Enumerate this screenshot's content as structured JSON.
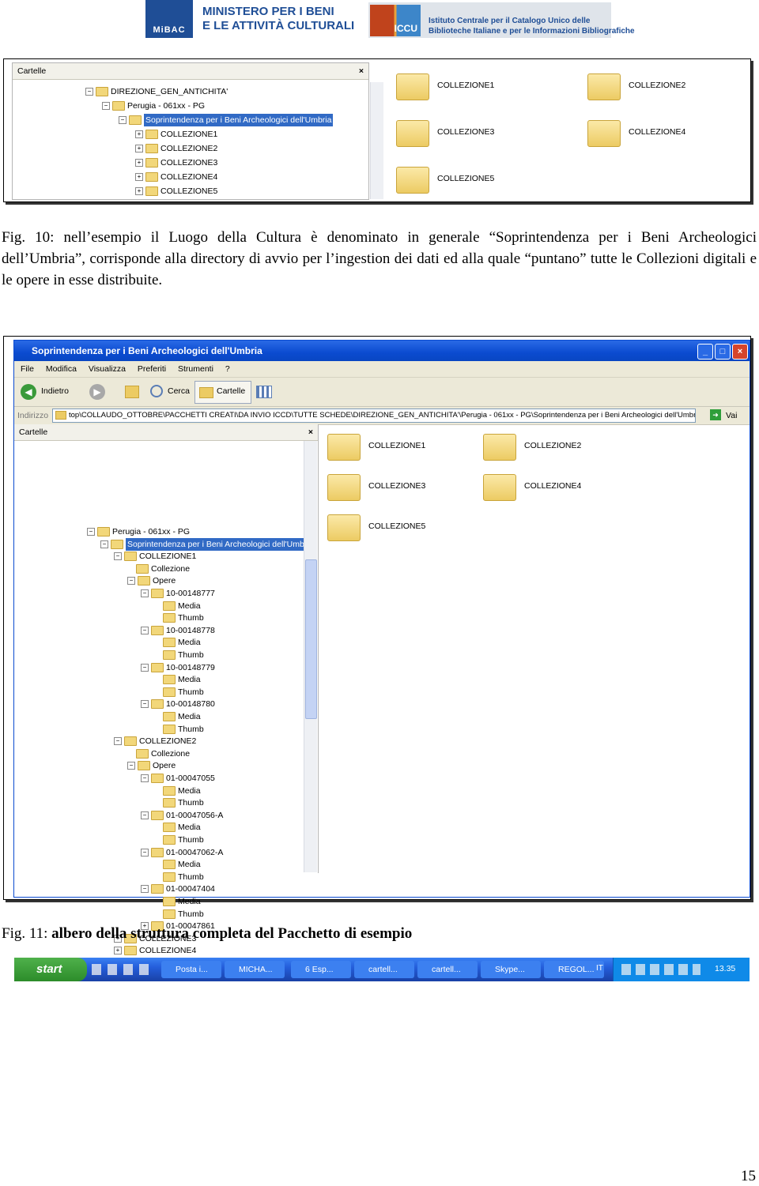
{
  "header": {
    "mibac_logo_text": "MiBAC",
    "ministry_line1": "MINISTERO PER I BENI",
    "ministry_line2": "E LE ATTIVITÀ CULTURALI",
    "iccu_logo_text": "ICCU",
    "iccu_line1": "Istituto Centrale per il Catalogo Unico delle",
    "iccu_line2": "Biblioteche Italiane e per le Informazioni Bibliografiche"
  },
  "fig10": {
    "panel_title": "Cartelle",
    "close": "×",
    "tree": [
      {
        "sign": "−",
        "label": "DIREZIONE_GEN_ANTICHITA'",
        "level": 0
      },
      {
        "sign": "−",
        "label": "Perugia - 061xx - PG",
        "level": 1
      },
      {
        "sign": "−",
        "label": "Soprintendenza per i Beni Archeologici dell'Umbria",
        "level": 2,
        "selected": true
      },
      {
        "sign": "+",
        "label": "COLLEZIONE1",
        "level": 3
      },
      {
        "sign": "+",
        "label": "COLLEZIONE2",
        "level": 3
      },
      {
        "sign": "+",
        "label": "COLLEZIONE3",
        "level": 3
      },
      {
        "sign": "+",
        "label": "COLLEZIONE4",
        "level": 3
      },
      {
        "sign": "+",
        "label": "COLLEZIONE5",
        "level": 3
      }
    ],
    "folders": [
      "COLLEZIONE1",
      "COLLEZIONE2",
      "COLLEZIONE3",
      "COLLEZIONE4",
      "COLLEZIONE5"
    ],
    "caption_label": "Fig. 10:",
    "caption_text": "nell’esempio il Luogo della Cultura è denominato in generale “Soprintendenza per i Beni Archeologici dell’Umbria”, corrisponde alla directory di avvio per l’ingestion dei dati ed alla quale “puntano” tutte le Collezioni digitali e le opere in esse distribuite."
  },
  "fig11": {
    "window_title": "Soprintendenza per i Beni Archeologici dell'Umbria",
    "menu": [
      "File",
      "Modifica",
      "Visualizza",
      "Preferiti",
      "Strumenti",
      "?"
    ],
    "toolbar": {
      "back": "Indietro",
      "search": "Cerca",
      "folders": "Cartelle"
    },
    "address_label": "Indirizzo",
    "address_value": "top\\COLLAUDO_OTTOBRE\\PACCHETTI CREATI\\DA INVIO ICCD\\TUTTE SCHEDE\\DIREZIONE_GEN_ANTICHITA'\\Perugia - 061xx - PG\\Soprintendenza per i Beni Archeologici dell'Umbria",
    "go": "Vai",
    "panel_title": "Cartelle",
    "close": "×",
    "tree": [
      {
        "sign": "−",
        "label": "Perugia - 061xx - PG",
        "level": 0
      },
      {
        "sign": "−",
        "label": "Soprintendenza per i Beni Archeologici dell'Umbria",
        "level": 1,
        "selected": true
      },
      {
        "sign": "−",
        "label": "COLLEZIONE1",
        "level": 2
      },
      {
        "sign": "",
        "label": "Collezione",
        "level": 3
      },
      {
        "sign": "−",
        "label": "Opere",
        "level": 3
      },
      {
        "sign": "−",
        "label": "10-00148777",
        "level": 4
      },
      {
        "sign": "",
        "label": "Media",
        "level": 5
      },
      {
        "sign": "",
        "label": "Thumb",
        "level": 5
      },
      {
        "sign": "−",
        "label": "10-00148778",
        "level": 4
      },
      {
        "sign": "",
        "label": "Media",
        "level": 5
      },
      {
        "sign": "",
        "label": "Thumb",
        "level": 5
      },
      {
        "sign": "−",
        "label": "10-00148779",
        "level": 4
      },
      {
        "sign": "",
        "label": "Media",
        "level": 5
      },
      {
        "sign": "",
        "label": "Thumb",
        "level": 5
      },
      {
        "sign": "−",
        "label": "10-00148780",
        "level": 4
      },
      {
        "sign": "",
        "label": "Media",
        "level": 5
      },
      {
        "sign": "",
        "label": "Thumb",
        "level": 5
      },
      {
        "sign": "−",
        "label": "COLLEZIONE2",
        "level": 2
      },
      {
        "sign": "",
        "label": "Collezione",
        "level": 3
      },
      {
        "sign": "−",
        "label": "Opere",
        "level": 3
      },
      {
        "sign": "−",
        "label": "01-00047055",
        "level": 4
      },
      {
        "sign": "",
        "label": "Media",
        "level": 5
      },
      {
        "sign": "",
        "label": "Thumb",
        "level": 5
      },
      {
        "sign": "−",
        "label": "01-00047056-A",
        "level": 4
      },
      {
        "sign": "",
        "label": "Media",
        "level": 5
      },
      {
        "sign": "",
        "label": "Thumb",
        "level": 5
      },
      {
        "sign": "−",
        "label": "01-00047062-A",
        "level": 4
      },
      {
        "sign": "",
        "label": "Media",
        "level": 5
      },
      {
        "sign": "",
        "label": "Thumb",
        "level": 5
      },
      {
        "sign": "−",
        "label": "01-00047404",
        "level": 4
      },
      {
        "sign": "",
        "label": "Media",
        "level": 5
      },
      {
        "sign": "",
        "label": "Thumb",
        "level": 5
      },
      {
        "sign": "+",
        "label": "01-00047861",
        "level": 4
      },
      {
        "sign": "+",
        "label": "COLLEZIONE3",
        "level": 2
      },
      {
        "sign": "+",
        "label": "COLLEZIONE4",
        "level": 2
      }
    ],
    "folders": [
      "COLLEZIONE1",
      "COLLEZIONE2",
      "COLLEZIONE3",
      "COLLEZIONE4",
      "COLLEZIONE5"
    ],
    "taskbar": {
      "start": "start",
      "tasks": [
        "Posta i...",
        "MICHA...",
        "6 Esp...",
        "cartell...",
        "cartell...",
        "Skype...",
        "REGOL..."
      ],
      "lang": "IT",
      "clock": "13.35"
    },
    "caption_label": "Fig. 11:",
    "caption_text": "albero della struttura completa del Pacchetto di esempio"
  },
  "page_number": "15"
}
